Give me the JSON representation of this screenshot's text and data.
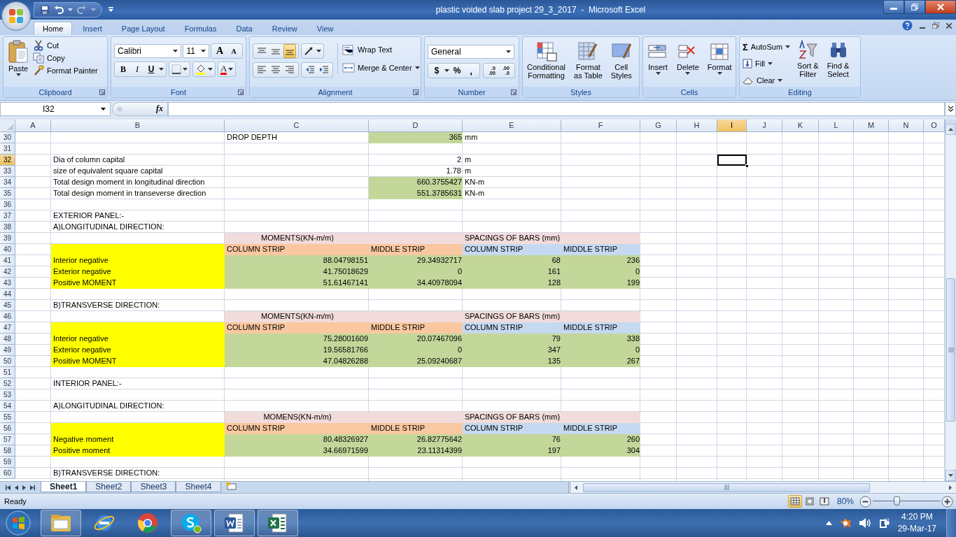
{
  "window": {
    "title": "plastic voided slab project 29_3_2017  -  Microsoft Excel"
  },
  "ribbon_tabs": [
    {
      "label": "Home",
      "selected": true
    },
    {
      "label": "Insert",
      "selected": false
    },
    {
      "label": "Page Layout",
      "selected": false
    },
    {
      "label": "Formulas",
      "selected": false
    },
    {
      "label": "Data",
      "selected": false
    },
    {
      "label": "Review",
      "selected": false
    },
    {
      "label": "View",
      "selected": false
    }
  ],
  "ribbon_groups": [
    {
      "kind": "clipboard",
      "label": "Clipboard",
      "paste": "Paste",
      "commands": [
        "Cut",
        "Copy",
        "Format Painter"
      ]
    },
    {
      "kind": "font",
      "label": "Font",
      "font_name": "Calibri",
      "font_size": "11",
      "grow": "A",
      "shrink": "A",
      "bold": "B",
      "italic": "I",
      "underline": "U",
      "font_color": "A"
    },
    {
      "kind": "alignment",
      "label": "Alignment",
      "vertical_align": [
        {
          "selected": false
        },
        {
          "selected": false
        },
        {
          "selected": true
        }
      ],
      "wrap": "Wrap Text",
      "merge": "Merge & Center"
    },
    {
      "kind": "number",
      "label": "Number",
      "format": "General",
      "currency": "$",
      "percent": "%",
      "comma": ",",
      "increase_decimal": [
        ".0",
        ".00"
      ],
      "decrease_decimal": [
        ".00",
        ".0"
      ]
    },
    {
      "kind": "styles",
      "label": "Styles",
      "buttons": [
        [
          "Conditional",
          "Formatting"
        ],
        [
          "Format",
          "as Table"
        ],
        [
          "Cell",
          "Styles"
        ]
      ]
    },
    {
      "kind": "cells",
      "label": "Cells",
      "buttons": [
        "Insert",
        "Delete",
        "Format"
      ]
    },
    {
      "kind": "editing",
      "label": "Editing",
      "sigma": "Σ",
      "commands": [
        "AutoSum",
        "Fill",
        "Clear"
      ],
      "buttons": [
        [
          "Sort &",
          "Filter"
        ],
        [
          "Find &",
          "Select"
        ]
      ]
    }
  ],
  "formula_bar": {
    "name_box": "I32",
    "fx": "fx"
  },
  "sheet": {
    "columns": [
      {
        "label": "A",
        "selected": false
      },
      {
        "label": "B",
        "selected": false
      },
      {
        "label": "C",
        "selected": false
      },
      {
        "label": "D",
        "selected": false
      },
      {
        "label": "E",
        "selected": false
      },
      {
        "label": "F",
        "selected": false
      },
      {
        "label": "G",
        "selected": false
      },
      {
        "label": "H",
        "selected": false
      },
      {
        "label": "I",
        "selected": true
      },
      {
        "label": "J",
        "selected": false
      },
      {
        "label": "K",
        "selected": false
      },
      {
        "label": "L",
        "selected": false
      },
      {
        "label": "M",
        "selected": false
      },
      {
        "label": "N",
        "selected": false
      },
      {
        "label": "O",
        "selected": false
      }
    ],
    "rows": [
      {
        "number": "30",
        "selected": false,
        "cells": [
          {
            "kind": "empty"
          },
          {
            "kind": "empty"
          },
          {
            "kind": "text",
            "text": "DROP DEPTH"
          },
          {
            "kind": "number",
            "text": "365",
            "color": "#c4d79b"
          },
          {
            "kind": "text",
            "text": "mm"
          }
        ]
      },
      {
        "number": "31",
        "selected": false
      },
      {
        "number": "32",
        "selected": true,
        "cells": [
          {
            "kind": "empty"
          },
          {
            "kind": "text",
            "text": "Dia of column capital"
          },
          {
            "kind": "empty"
          },
          {
            "kind": "number",
            "text": "2"
          },
          {
            "kind": "text",
            "text": "m"
          }
        ]
      },
      {
        "number": "33",
        "selected": false,
        "cells": [
          {
            "kind": "empty"
          },
          {
            "kind": "text",
            "text": "size of equivalent square capital"
          },
          {
            "kind": "empty"
          },
          {
            "kind": "number",
            "text": "1.78"
          },
          {
            "kind": "text",
            "text": "m"
          }
        ]
      },
      {
        "number": "34",
        "selected": false,
        "cells": [
          {
            "kind": "empty"
          },
          {
            "kind": "text",
            "text": "Total design moment in longitudinal direction"
          },
          {
            "kind": "empty"
          },
          {
            "kind": "number",
            "text": "660.3755427",
            "color": "#c4d79b"
          },
          {
            "kind": "text",
            "text": "KN-m"
          }
        ]
      },
      {
        "number": "35",
        "selected": false,
        "cells": [
          {
            "kind": "empty"
          },
          {
            "kind": "text",
            "text": "Total design moment in transeverse direction"
          },
          {
            "kind": "empty"
          },
          {
            "kind": "number",
            "text": "551.3785631",
            "color": "#c4d79b"
          },
          {
            "kind": "text",
            "text": "KN-m"
          }
        ]
      },
      {
        "number": "36",
        "selected": false
      },
      {
        "number": "37",
        "selected": false,
        "cells": [
          {
            "kind": "empty"
          },
          {
            "kind": "text",
            "text": "EXTERIOR PANEL:-"
          }
        ]
      },
      {
        "number": "38",
        "selected": false,
        "cells": [
          {
            "kind": "empty"
          },
          {
            "kind": "text",
            "text": "A)LONGITUDINAL DIRECTION:"
          }
        ]
      },
      {
        "number": "39",
        "selected": false,
        "cells": [
          {
            "kind": "empty"
          },
          {
            "kind": "empty"
          },
          {
            "kind": "heading",
            "text": "MOMENTS(KN-m/m)",
            "color": "#f2dcdb"
          },
          {
            "kind": "fill",
            "color": "#f2dcdb"
          },
          {
            "kind": "text",
            "text": "SPACINGS OF BARS (mm)",
            "color": "#f2dcdb"
          },
          {
            "kind": "fill",
            "color": "#f2dcdb"
          }
        ]
      },
      {
        "number": "40",
        "selected": false,
        "cells": [
          {
            "kind": "empty"
          },
          {
            "kind": "fill",
            "color": "#ffff00"
          },
          {
            "kind": "text",
            "text": "COLUMN STRIP",
            "color": "#fac8a0"
          },
          {
            "kind": "text",
            "text": "MIDDLE STRIP",
            "color": "#fac8a0"
          },
          {
            "kind": "text",
            "text": "COLUMN STRIP",
            "color": "#c5d9f1"
          },
          {
            "kind": "text",
            "text": "MIDDLE STRIP",
            "color": "#c5d9f1"
          }
        ]
      },
      {
        "number": "41",
        "selected": false,
        "cells": [
          {
            "kind": "empty"
          },
          {
            "kind": "text",
            "text": "Interior negative",
            "color": "#ffff00"
          },
          {
            "kind": "number",
            "text": "88.04798151",
            "color": "#c4d79b"
          },
          {
            "kind": "number",
            "text": "29.34932717",
            "color": "#c4d79b"
          },
          {
            "kind": "number",
            "text": "68",
            "color": "#c4d79b"
          },
          {
            "kind": "number",
            "text": "236",
            "color": "#c4d79b"
          }
        ]
      },
      {
        "number": "42",
        "selected": false,
        "cells": [
          {
            "kind": "empty"
          },
          {
            "kind": "text",
            "text": "Exterior negative",
            "color": "#ffff00"
          },
          {
            "kind": "number",
            "text": "41.75018629",
            "color": "#c4d79b"
          },
          {
            "kind": "number",
            "text": "0",
            "color": "#c4d79b"
          },
          {
            "kind": "number",
            "text": "161",
            "color": "#c4d79b"
          },
          {
            "kind": "number",
            "text": "0",
            "color": "#c4d79b"
          }
        ]
      },
      {
        "number": "43",
        "selected": false,
        "cells": [
          {
            "kind": "empty"
          },
          {
            "kind": "text",
            "text": "Positive MOMENT",
            "color": "#ffff00"
          },
          {
            "kind": "number",
            "text": "51.61467141",
            "color": "#c4d79b"
          },
          {
            "kind": "number",
            "text": "34.40978094",
            "color": "#c4d79b"
          },
          {
            "kind": "number",
            "text": "128",
            "color": "#c4d79b"
          },
          {
            "kind": "number",
            "text": "199",
            "color": "#c4d79b"
          }
        ]
      },
      {
        "number": "44",
        "selected": false
      },
      {
        "number": "45",
        "selected": false,
        "cells": [
          {
            "kind": "empty"
          },
          {
            "kind": "text",
            "text": "B)TRANSVERSE DIRECTION:"
          }
        ]
      },
      {
        "number": "46",
        "selected": false,
        "cells": [
          {
            "kind": "empty"
          },
          {
            "kind": "empty"
          },
          {
            "kind": "heading",
            "text": "MOMENTS(KN-m/m)",
            "color": "#f2dcdb"
          },
          {
            "kind": "fill",
            "color": "#f2dcdb"
          },
          {
            "kind": "text",
            "text": "SPACINGS OF BARS  (mm)",
            "color": "#f2dcdb"
          },
          {
            "kind": "fill",
            "color": "#f2dcdb"
          }
        ]
      },
      {
        "number": "47",
        "selected": false,
        "cells": [
          {
            "kind": "empty"
          },
          {
            "kind": "fill",
            "color": "#ffff00"
          },
          {
            "kind": "text",
            "text": "COLUMN STRIP",
            "color": "#fac8a0"
          },
          {
            "kind": "text",
            "text": "MIDDLE STRIP",
            "color": "#fac8a0"
          },
          {
            "kind": "text",
            "text": "COLUMN STRIP",
            "color": "#c5d9f1"
          },
          {
            "kind": "text",
            "text": "MIDDLE STRIP",
            "color": "#c5d9f1"
          }
        ]
      },
      {
        "number": "48",
        "selected": false,
        "cells": [
          {
            "kind": "empty"
          },
          {
            "kind": "text",
            "text": "Interior negative",
            "color": "#ffff00"
          },
          {
            "kind": "number",
            "text": "75.28001609",
            "color": "#c4d79b"
          },
          {
            "kind": "number",
            "text": "20.07467096",
            "color": "#c4d79b"
          },
          {
            "kind": "number",
            "text": "79",
            "color": "#c4d79b"
          },
          {
            "kind": "number",
            "text": "338",
            "color": "#c4d79b"
          }
        ]
      },
      {
        "number": "49",
        "selected": false,
        "cells": [
          {
            "kind": "empty"
          },
          {
            "kind": "text",
            "text": "Exterior negative",
            "color": "#ffff00"
          },
          {
            "kind": "number",
            "text": "19.56581766",
            "color": "#c4d79b"
          },
          {
            "kind": "number",
            "text": "0",
            "color": "#c4d79b"
          },
          {
            "kind": "number",
            "text": "347",
            "color": "#c4d79b"
          },
          {
            "kind": "number",
            "text": "0",
            "color": "#c4d79b"
          }
        ]
      },
      {
        "number": "50",
        "selected": false,
        "cells": [
          {
            "kind": "empty"
          },
          {
            "kind": "text",
            "text": "Positive MOMENT",
            "color": "#ffff00"
          },
          {
            "kind": "number",
            "text": "47.04826288",
            "color": "#c4d79b"
          },
          {
            "kind": "number",
            "text": "25.09240687",
            "color": "#c4d79b"
          },
          {
            "kind": "number",
            "text": "135",
            "color": "#c4d79b"
          },
          {
            "kind": "number",
            "text": "267",
            "color": "#c4d79b"
          }
        ]
      },
      {
        "number": "51",
        "selected": false
      },
      {
        "number": "52",
        "selected": false,
        "cells": [
          {
            "kind": "empty"
          },
          {
            "kind": "text",
            "text": "INTERIOR PANEL:-"
          }
        ]
      },
      {
        "number": "53",
        "selected": false
      },
      {
        "number": "54",
        "selected": false,
        "cells": [
          {
            "kind": "empty"
          },
          {
            "kind": "text",
            "text": "A)LONGITUDINAL DIRECTION:"
          }
        ]
      },
      {
        "number": "55",
        "selected": false,
        "cells": [
          {
            "kind": "empty"
          },
          {
            "kind": "empty"
          },
          {
            "kind": "heading",
            "text": "MOMENS(KN-m/m)",
            "color": "#f2dcdb"
          },
          {
            "kind": "fill",
            "color": "#f2dcdb"
          },
          {
            "kind": "text",
            "text": "SPACINGS OF BARS (mm)",
            "color": "#f2dcdb"
          },
          {
            "kind": "fill",
            "color": "#f2dcdb"
          }
        ]
      },
      {
        "number": "56",
        "selected": false,
        "cells": [
          {
            "kind": "empty"
          },
          {
            "kind": "fill",
            "color": "#ffff00"
          },
          {
            "kind": "text",
            "text": "COLUMN STRIP",
            "color": "#fac8a0"
          },
          {
            "kind": "text",
            "text": "MIDDLE STRIP",
            "color": "#fac8a0"
          },
          {
            "kind": "text",
            "text": "COLUMN STRIP",
            "color": "#c5d9f1"
          },
          {
            "kind": "text",
            "text": "MIDDLE STRIP",
            "color": "#c5d9f1"
          }
        ]
      },
      {
        "number": "57",
        "selected": false,
        "cells": [
          {
            "kind": "empty"
          },
          {
            "kind": "text",
            "text": "Negative moment",
            "color": "#ffff00"
          },
          {
            "kind": "number",
            "text": "80.48326927",
            "color": "#c4d79b"
          },
          {
            "kind": "number",
            "text": "26.82775642",
            "color": "#c4d79b"
          },
          {
            "kind": "number",
            "text": "76",
            "color": "#c4d79b"
          },
          {
            "kind": "number",
            "text": "260",
            "color": "#c4d79b"
          }
        ]
      },
      {
        "number": "58",
        "selected": false,
        "cells": [
          {
            "kind": "empty"
          },
          {
            "kind": "text",
            "text": "Positive moment",
            "color": "#ffff00"
          },
          {
            "kind": "number",
            "text": "34.66971599",
            "color": "#c4d79b"
          },
          {
            "kind": "number",
            "text": "23.11314399",
            "color": "#c4d79b"
          },
          {
            "kind": "number",
            "text": "197",
            "color": "#c4d79b"
          },
          {
            "kind": "number",
            "text": "304",
            "color": "#c4d79b"
          }
        ]
      },
      {
        "number": "59",
        "selected": false
      },
      {
        "number": "60",
        "selected": false,
        "cells": [
          {
            "kind": "empty"
          },
          {
            "kind": "text",
            "text": "B)TRANSVERSE DIRECTION:"
          }
        ]
      }
    ]
  },
  "sheet_tabs": [
    {
      "label": "Sheet1",
      "selected": true
    },
    {
      "label": "Sheet2",
      "selected": false
    },
    {
      "label": "Sheet3",
      "selected": false
    },
    {
      "label": "Sheet4",
      "selected": false
    }
  ],
  "status_bar": {
    "status": "Ready",
    "views": [
      {
        "selected": true
      },
      {
        "selected": false
      },
      {
        "selected": false
      }
    ],
    "zoom": "80%",
    "zoom_slider": {
      "level": 0.35
    }
  },
  "taskbar": {
    "time": "4:20 PM",
    "date": "29-Mar-17"
  }
}
